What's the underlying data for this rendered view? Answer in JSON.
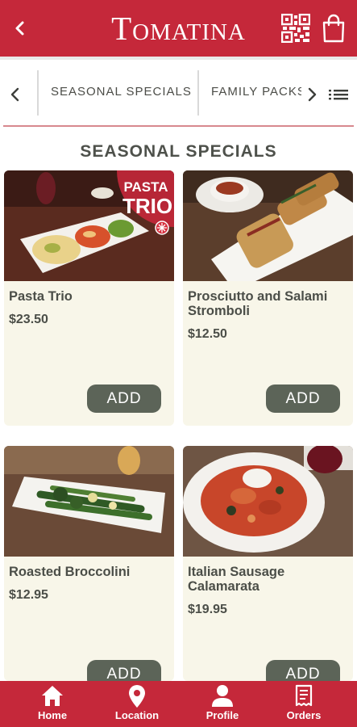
{
  "header": {
    "brand": "Tomatina"
  },
  "categories": {
    "tabs": [
      "SEASONAL SPECIALS",
      "FAMILY PACKS"
    ]
  },
  "section": {
    "title": "SEASONAL SPECIALS"
  },
  "photo_badge": {
    "line1": "PASTA",
    "line2": "TRIO"
  },
  "items": [
    {
      "name": "Pasta Trio",
      "price": "$23.50",
      "add_label": "ADD"
    },
    {
      "name": "Prosciutto and Salami Stromboli",
      "price": "$12.50",
      "add_label": "ADD"
    },
    {
      "name": "Roasted Broccolini",
      "price": "$12.95",
      "add_label": "ADD"
    },
    {
      "name": "Italian Sausage Calamarata",
      "price": "$19.95",
      "add_label": "ADD"
    }
  ],
  "nav": [
    {
      "label": "Home",
      "icon": "home-icon"
    },
    {
      "label": "Location",
      "icon": "location-pin-icon"
    },
    {
      "label": "Profile",
      "icon": "person-icon"
    },
    {
      "label": "Orders",
      "icon": "receipt-icon"
    }
  ],
  "colors": {
    "brand_red": "#c5283a",
    "card_bg": "#f8f6e9",
    "button": "#5c6458",
    "text": "#4b4e48"
  }
}
